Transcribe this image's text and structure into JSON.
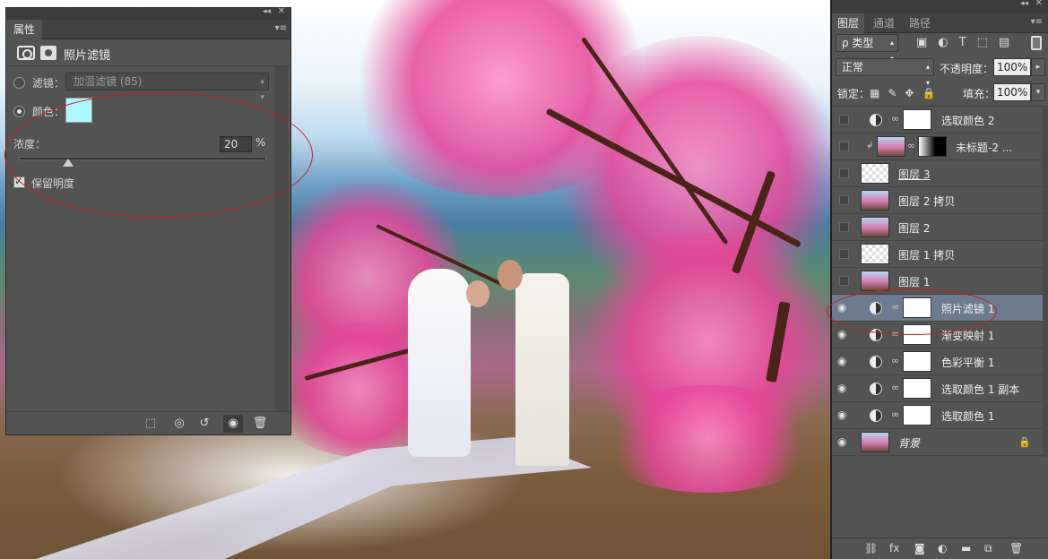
{
  "properties": {
    "tab": "属性",
    "header_title": "照片滤镜",
    "filter_label": "滤镜：",
    "filter_value": "加温滤镜 (85)",
    "color_label": "颜色：",
    "color_hex": "#aef8ff",
    "density_label": "浓度：",
    "density_value": "20",
    "density_unit": "%",
    "density_percent": 20,
    "preserve_label": "保留明度",
    "preserve_checked": true
  },
  "layers_panel": {
    "tabs": [
      "图层",
      "通道",
      "路径"
    ],
    "kind_label": "ρ 类型",
    "blend_mode": "正常",
    "opacity_label": "不透明度：",
    "opacity_value": "100%",
    "lock_label": "锁定：",
    "fill_label": "填充：",
    "fill_value": "100%",
    "layers": [
      {
        "name": "选取颜色 2",
        "visible": false,
        "type": "adjustment"
      },
      {
        "name": "未标题-2 ...",
        "visible": false,
        "type": "clipped"
      },
      {
        "name": "图层 3",
        "visible": false,
        "type": "blank"
      },
      {
        "name": "图层 2 拷贝",
        "visible": false,
        "type": "image"
      },
      {
        "name": "图层 2",
        "visible": false,
        "type": "image"
      },
      {
        "name": "图层 1 拷贝",
        "visible": false,
        "type": "checker"
      },
      {
        "name": "图层 1",
        "visible": false,
        "type": "image"
      },
      {
        "name": "照片滤镜 1",
        "visible": true,
        "type": "adjustment",
        "selected": true
      },
      {
        "name": "渐变映射 1",
        "visible": true,
        "type": "adjustment"
      },
      {
        "name": "色彩平衡 1",
        "visible": true,
        "type": "adjustment"
      },
      {
        "name": "选取颜色 1 副本",
        "visible": true,
        "type": "adjustment"
      },
      {
        "name": "选取颜色 1",
        "visible": true,
        "type": "adjustment"
      },
      {
        "name": "背景",
        "visible": true,
        "type": "background",
        "locked": true
      }
    ]
  },
  "colors": {
    "annotation": "#c81d1d",
    "selected_row": "#6c7b8f",
    "panel_bg": "#535353"
  }
}
